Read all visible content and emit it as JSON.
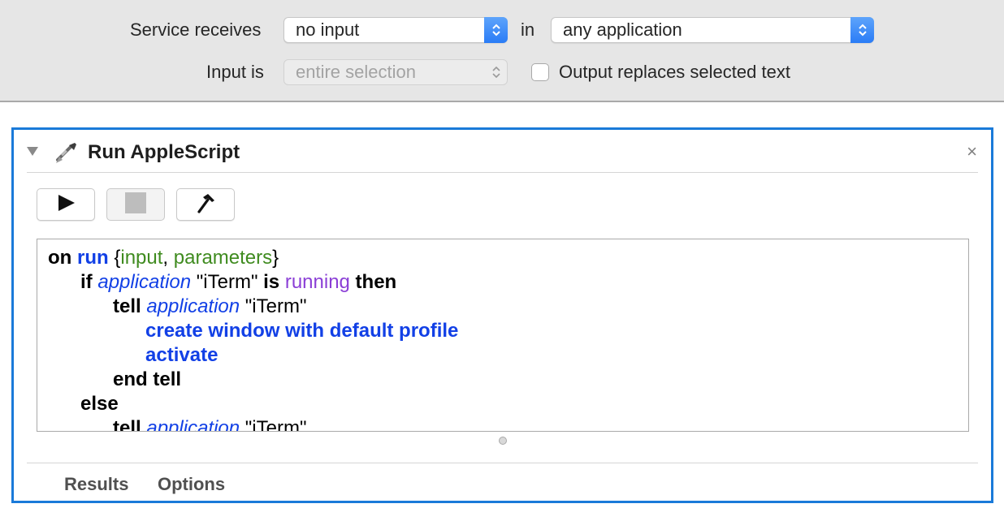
{
  "config": {
    "service_receives_label": "Service receives",
    "service_receives_value": "no input",
    "in_label": "in",
    "application_value": "any application",
    "input_is_label": "Input is",
    "input_is_value": "entire selection",
    "output_replaces_label": "Output replaces selected text",
    "output_replaces_checked": false
  },
  "action": {
    "title": "Run AppleScript",
    "close_glyph": "×",
    "tabs": [
      {
        "label": "Results"
      },
      {
        "label": "Options"
      }
    ]
  },
  "script": {
    "lines": [
      {
        "tokens": [
          {
            "t": "on ",
            "c": "kw"
          },
          {
            "t": "run",
            "c": "cmd"
          },
          {
            "t": " {",
            "c": "plain"
          },
          {
            "t": "input",
            "c": "var"
          },
          {
            "t": ", ",
            "c": "plain"
          },
          {
            "t": "parameters",
            "c": "var"
          },
          {
            "t": "}",
            "c": "plain"
          }
        ]
      },
      {
        "tokens": [
          {
            "t": "      if ",
            "c": "kw"
          },
          {
            "t": "application",
            "c": "cls"
          },
          {
            "t": " \"iTerm\" ",
            "c": "plain"
          },
          {
            "t": "is ",
            "c": "kw"
          },
          {
            "t": "running",
            "c": "prop"
          },
          {
            "t": " then",
            "c": "kw"
          }
        ]
      },
      {
        "tokens": [
          {
            "t": "            tell ",
            "c": "kw"
          },
          {
            "t": "application",
            "c": "cls"
          },
          {
            "t": " \"iTerm\"",
            "c": "plain"
          }
        ]
      },
      {
        "tokens": [
          {
            "t": "                  create window with default profile",
            "c": "cmd"
          }
        ]
      },
      {
        "tokens": [
          {
            "t": "                  activate",
            "c": "cmd"
          }
        ]
      },
      {
        "tokens": [
          {
            "t": "            end tell",
            "c": "kw"
          }
        ]
      },
      {
        "tokens": [
          {
            "t": "      else",
            "c": "kw"
          }
        ]
      },
      {
        "tokens": [
          {
            "t": "            tell ",
            "c": "kw"
          },
          {
            "t": "application",
            "c": "cls"
          },
          {
            "t": " \"iTerm\"",
            "c": "plain"
          }
        ]
      }
    ]
  },
  "colors": {
    "accent": "#1a7ad9",
    "keyword": "#000000",
    "command": "#1240e6",
    "variable": "#3f8b1f",
    "property": "#8b3fd6"
  },
  "icons": {
    "disclosure": "disclosure-triangle-icon",
    "action": "applescript-icon",
    "run": "play-icon",
    "stop": "stop-icon",
    "compile": "hammer-icon",
    "close": "close-icon",
    "popup": "up-down-chevron-icon"
  }
}
